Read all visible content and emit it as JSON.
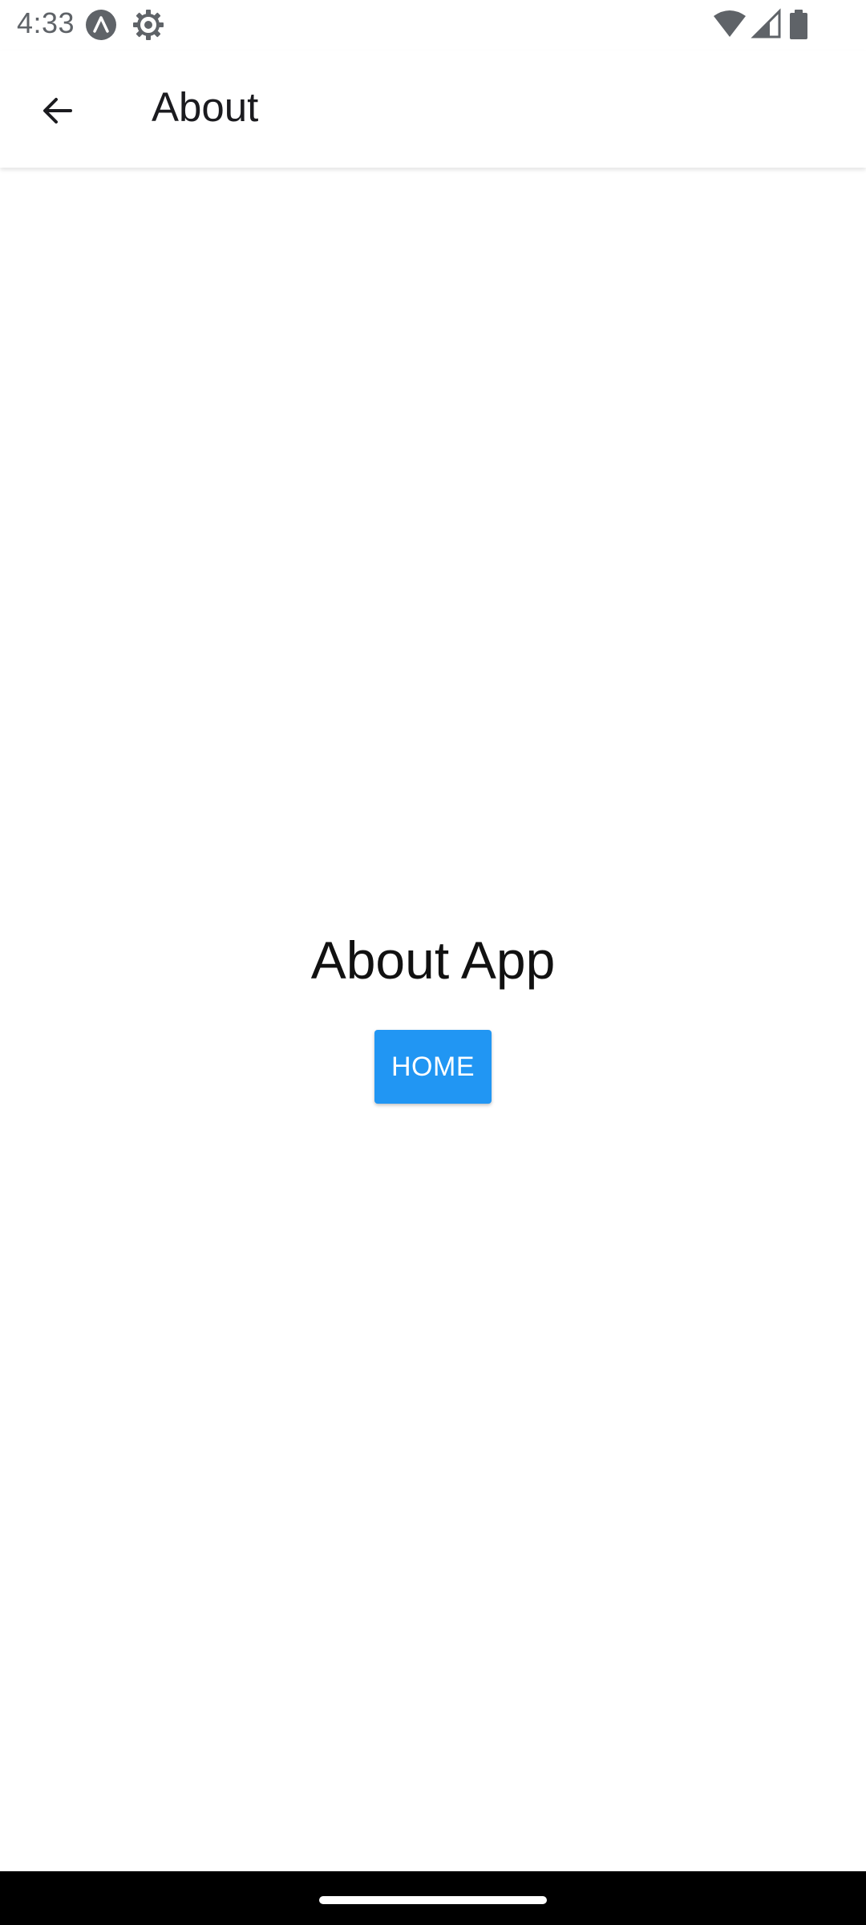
{
  "status_bar": {
    "time": "4:33",
    "left_icons": [
      "app-badge-icon",
      "settings-gear-icon"
    ],
    "right_icons": [
      "wifi-icon",
      "cell-signal-icon",
      "battery-icon"
    ]
  },
  "app_bar": {
    "back_icon": "arrow-back-icon",
    "title": "About"
  },
  "main": {
    "heading": "About App",
    "home_button_label": "HOME"
  },
  "colors": {
    "primary_button": "#2196f3",
    "status_icons": "#5f6368",
    "nav_bar": "#000000"
  }
}
